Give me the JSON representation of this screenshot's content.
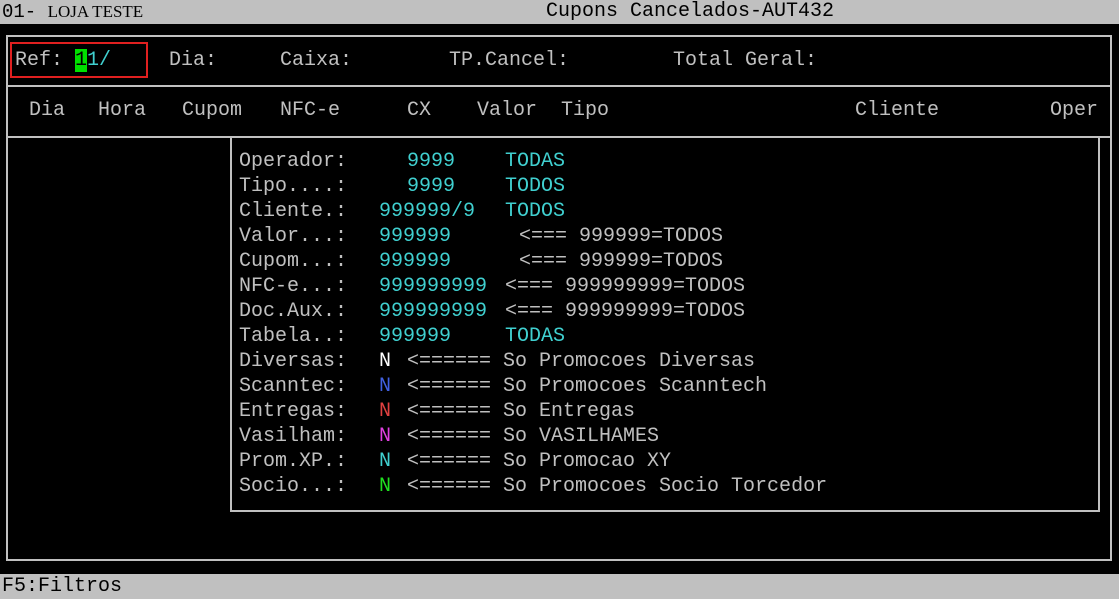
{
  "titlebar": {
    "store_code": "01-",
    "store_name": "LOJA TESTE",
    "title": "Cupons Cancelados-AUT432"
  },
  "header": {
    "ref_label": "Ref:",
    "ref_cursor": "1",
    "ref_value": "1/",
    "dia_label": "Dia:",
    "caixa_label": "Caixa:",
    "tpcancel_label": "TP.Cancel:",
    "total_label": "Total Geral:"
  },
  "columns": [
    "Dia",
    "Hora",
    "Cupom",
    "NFC-e",
    "CX",
    "Valor",
    "Tipo",
    "Cliente",
    "Oper"
  ],
  "filters": [
    {
      "label": "Operador:",
      "value": "9999",
      "note": "TODAS"
    },
    {
      "label": "Tipo....:",
      "value": "9999",
      "note": "TODOS"
    },
    {
      "label": "Cliente.:",
      "value": "999999/9",
      "note": "TODOS"
    },
    {
      "label": "Valor...:",
      "value": "999999",
      "note": "<=== 999999=TODOS"
    },
    {
      "label": "Cupom...:",
      "value": "999999",
      "note": "<=== 999999=TODOS"
    },
    {
      "label": "NFC-e...:",
      "value": "999999999",
      "note": "<=== 999999999=TODOS"
    },
    {
      "label": "Doc.Aux.:",
      "value": "999999999",
      "note": "<=== 999999999=TODOS"
    },
    {
      "label": "Tabela..:",
      "value": "999999",
      "note": "TODAS"
    },
    {
      "label": "Diversas:",
      "value": "N",
      "note": "<====== So Promocoes Diversas"
    },
    {
      "label": "Scanntec:",
      "value": "N",
      "note": "<====== So Promocoes Scanntech"
    },
    {
      "label": "Entregas:",
      "value": "N",
      "note": "<====== So Entregas"
    },
    {
      "label": "Vasilham:",
      "value": "N",
      "note": "<====== So VASILHAMES"
    },
    {
      "label": "Prom.XP.:",
      "value": "N",
      "note": "<====== So Promocao XY"
    },
    {
      "label": "Socio...:",
      "value": "N",
      "note": "<====== So Promocoes Socio Torcedor"
    }
  ],
  "flag_colors": {
    "diversas": "#ffffff",
    "scanntec": "#4060e0",
    "entregas": "#e04040",
    "vasilham": "#e040e0",
    "promxp": "#40d0d0",
    "socio": "#20e020"
  },
  "statusbar": {
    "hint": "F5:Filtros"
  }
}
